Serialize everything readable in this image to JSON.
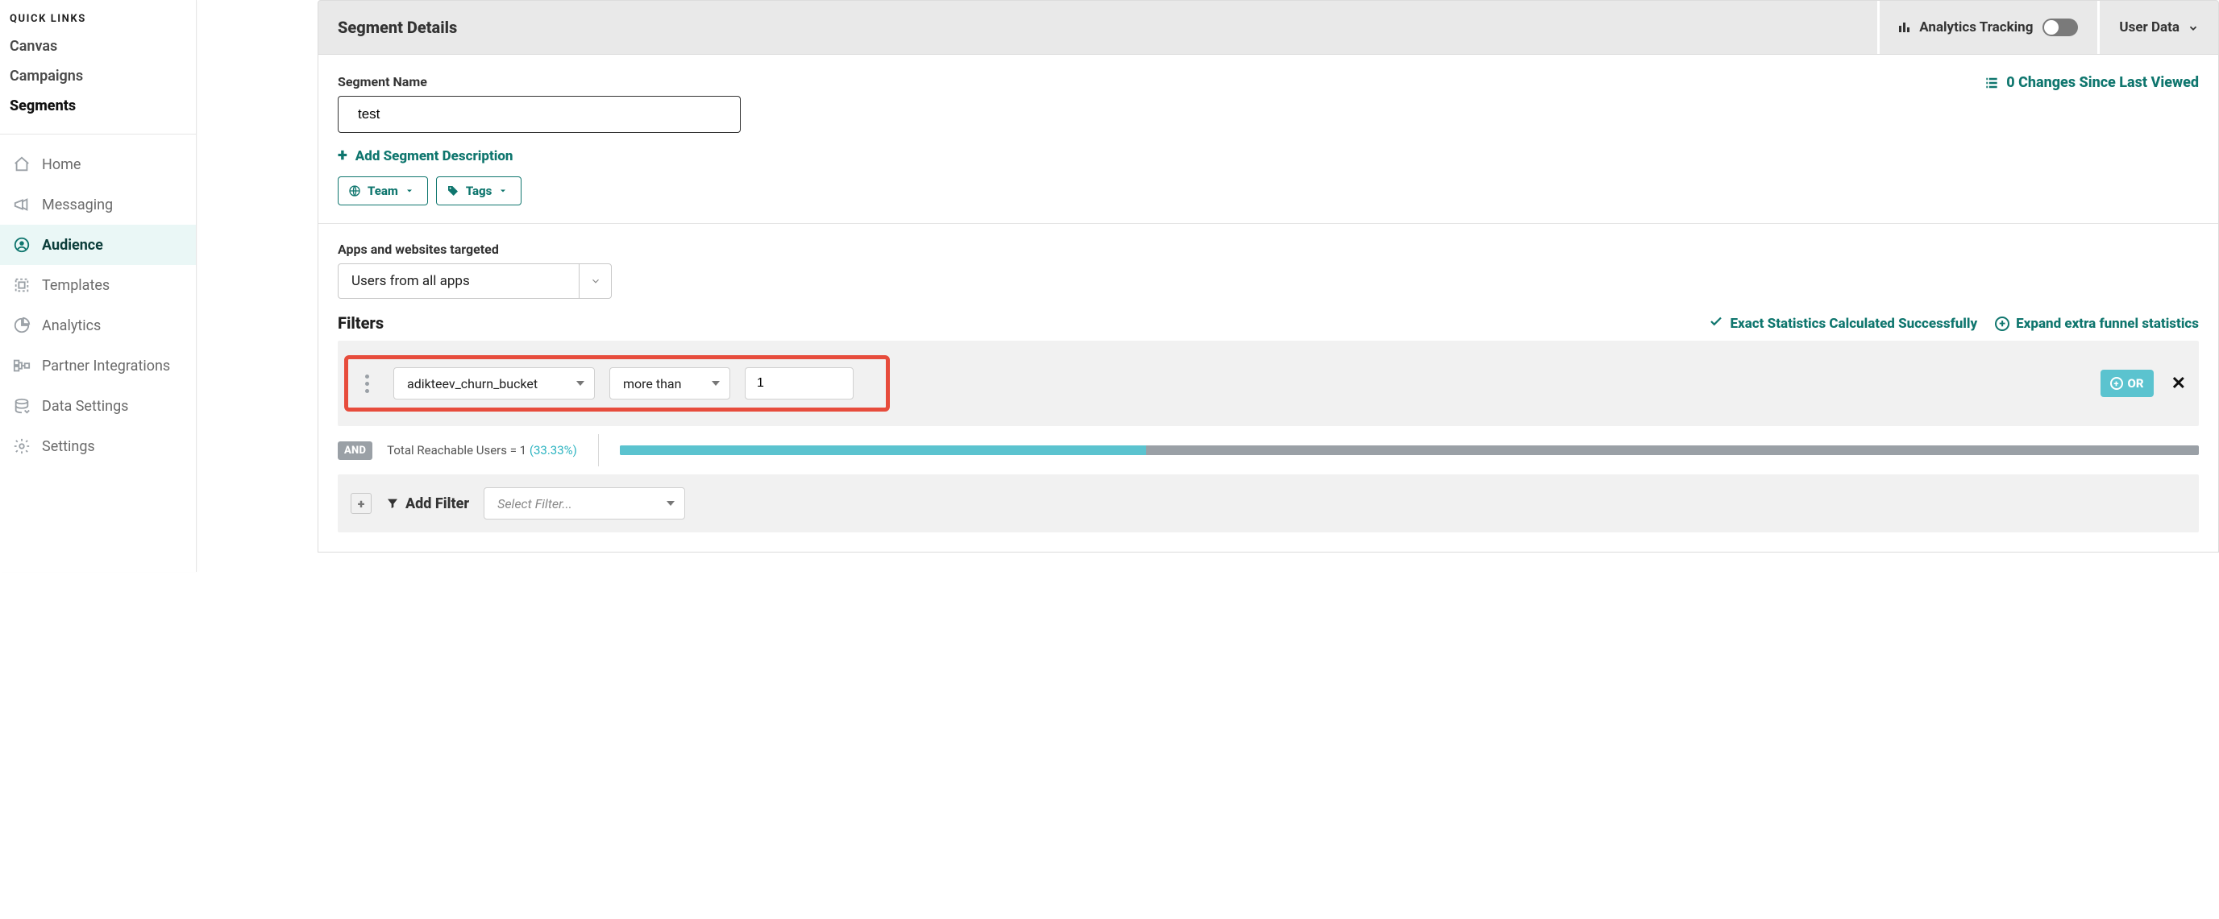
{
  "sidebar": {
    "quick_links_header": "QUICK LINKS",
    "quick_links": [
      {
        "label": "Canvas"
      },
      {
        "label": "Campaigns"
      },
      {
        "label": "Segments",
        "active": true
      }
    ],
    "nav": [
      {
        "label": "Home"
      },
      {
        "label": "Messaging"
      },
      {
        "label": "Audience",
        "active": true
      },
      {
        "label": "Templates"
      },
      {
        "label": "Analytics"
      },
      {
        "label": "Partner Integrations"
      },
      {
        "label": "Data Settings"
      },
      {
        "label": "Settings"
      }
    ]
  },
  "header": {
    "title": "Segment Details",
    "analytics_label": "Analytics Tracking",
    "user_data_label": "User Data"
  },
  "segment": {
    "name_label": "Segment Name",
    "name_value": "test",
    "changes_link": "0 Changes Since Last Viewed",
    "add_description": "Add Segment Description",
    "team_chip": "Team",
    "tags_chip": "Tags"
  },
  "targeting": {
    "apps_label": "Apps and websites targeted",
    "apps_value": "Users from all apps"
  },
  "filters": {
    "title": "Filters",
    "stats_ok": "Exact Statistics Calculated Successfully",
    "expand_extra": "Expand extra funnel statistics",
    "attribute": "adikteev_churn_bucket",
    "operator": "more than",
    "value": "1",
    "or_label": "OR",
    "and_label": "AND",
    "reach_label": "Total Reachable Users = ",
    "reach_count": "1",
    "reach_pct": "(33.33%)",
    "progress_pct": 33.33,
    "add_filter_label": "Add Filter",
    "select_filter_placeholder": "Select Filter..."
  }
}
